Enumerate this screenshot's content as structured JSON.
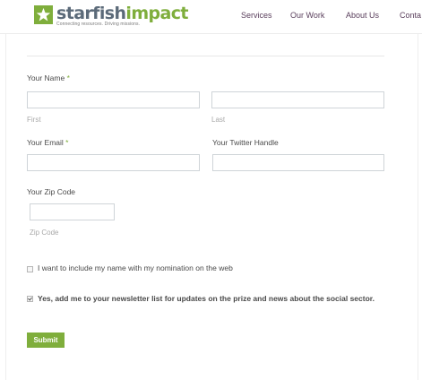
{
  "header": {
    "logo": {
      "brand_part1": "starfish",
      "brand_part2": "impact",
      "tagline": "Connecting resources. Driving missions."
    },
    "nav": [
      {
        "label": "Services"
      },
      {
        "label": "Our Work"
      },
      {
        "label": "About Us"
      },
      {
        "label": "Conta"
      }
    ]
  },
  "form": {
    "name": {
      "label": "Your Name",
      "required_mark": "*",
      "first_sublabel": "First",
      "last_sublabel": "Last",
      "first_value": "",
      "last_value": ""
    },
    "email": {
      "label": "Your Email",
      "required_mark": "*",
      "value": ""
    },
    "twitter": {
      "label": "Your Twitter Handle",
      "value": ""
    },
    "zip": {
      "label": "Your Zip Code",
      "sublabel": "Zip Code",
      "value": ""
    },
    "include_name": {
      "label": "I want to include my name with my nomination on the web",
      "checked": false
    },
    "newsletter": {
      "label": "Yes, add me to your newsletter list for updates on the prize and news about the social sector.",
      "checked": true
    },
    "submit_label": "Submit"
  },
  "colors": {
    "brand_green": "#7fae3c",
    "brand_slate": "#5b6a79",
    "nav_text": "#5a3f5c"
  }
}
